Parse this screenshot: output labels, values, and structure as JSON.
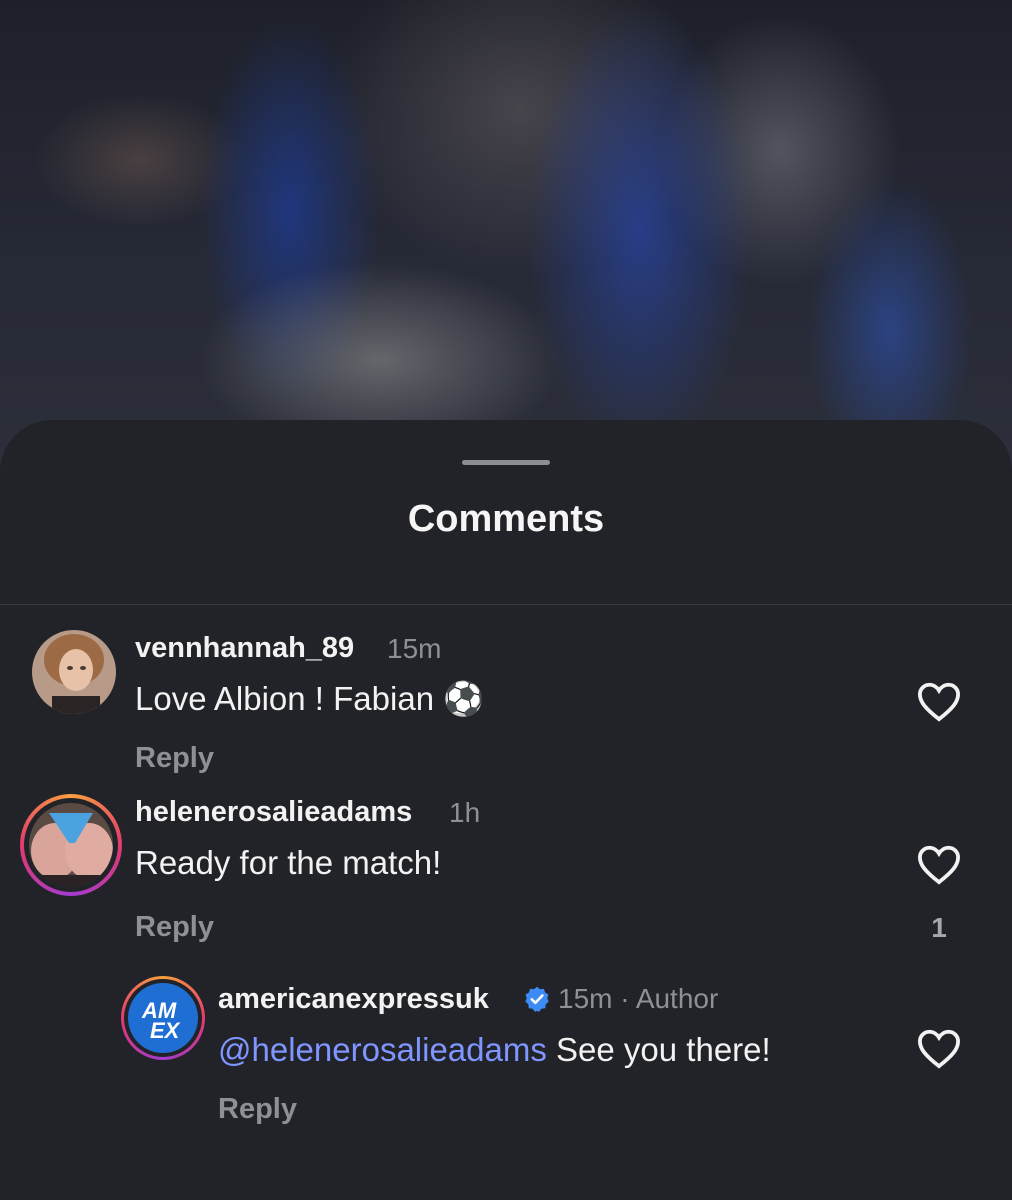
{
  "sheet": {
    "title": "Comments"
  },
  "comments": [
    {
      "username": "vennhannah_89",
      "time": "15m",
      "text": "Love Albion ! Fabian",
      "emoji": "⚽",
      "reply_label": "Reply",
      "like_icon": "heart-outline-icon"
    },
    {
      "username": "helenerosalieadams",
      "time": "1h",
      "text": "Ready for the match!",
      "reply_label": "Reply",
      "like_icon": "heart-outline-icon",
      "like_count": "1"
    }
  ],
  "reply": {
    "username": "americanexpressuk",
    "verified_icon": "verified-badge-icon",
    "time": "15m",
    "separator": "·",
    "author_label": "Author",
    "mention": "@helenerosalieadams",
    "text": "See you there!",
    "reply_label": "Reply",
    "like_icon": "heart-outline-icon",
    "avatar_logo_text": "AM EX"
  },
  "colors": {
    "sheet_bg": "#222328",
    "mention": "#7f95ff",
    "verified": "#3d8cf5"
  }
}
